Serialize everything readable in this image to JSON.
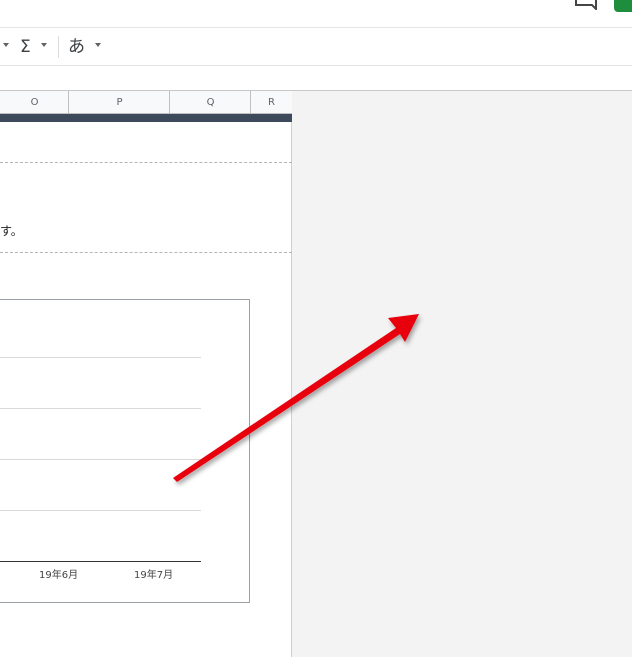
{
  "toolbar": {
    "sum_glyph": "Σ",
    "input_glyph": "あ"
  },
  "columns": [
    "O",
    "P",
    "Q",
    "R"
  ],
  "cell": {
    "text": "す。"
  },
  "chart_data": {
    "type": "line",
    "categories": [
      "19年6月",
      "19年7月"
    ],
    "series": [],
    "title": "",
    "xlabel": "",
    "ylabel": ""
  },
  "annotation": {
    "arrow_color": "#e8000b"
  }
}
